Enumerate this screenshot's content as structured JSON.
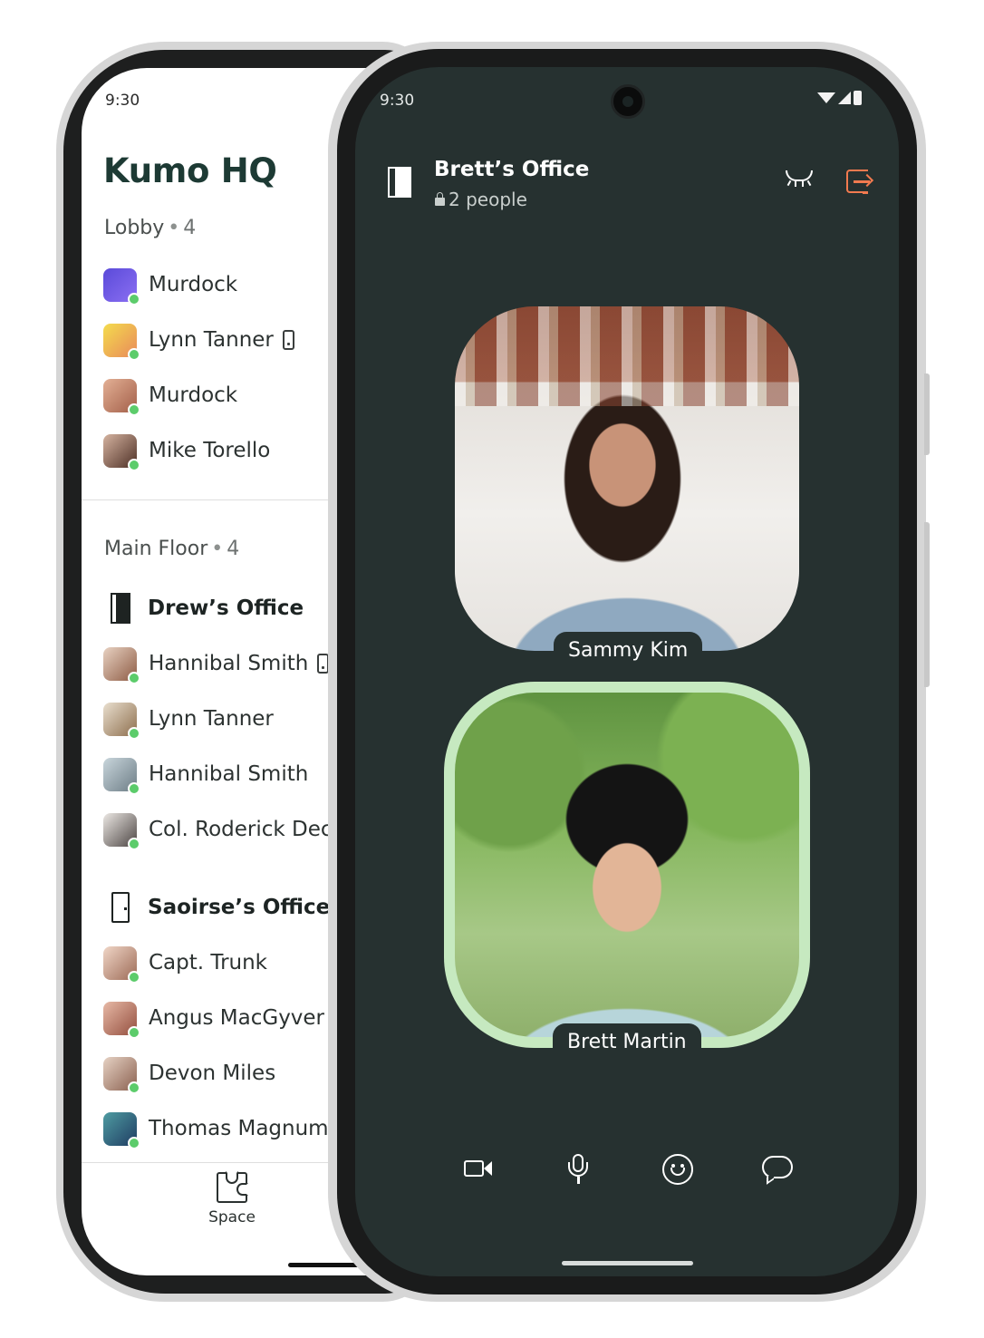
{
  "back_phone": {
    "status_time": "9:30",
    "app_title": "Kumo HQ",
    "lobby": {
      "title": "Lobby",
      "count": "4",
      "members": [
        {
          "name": "Murdock",
          "avatar_color": "#6b57e6",
          "on_mobile": false
        },
        {
          "name": "Lynn Tanner",
          "avatar_color": "#f0d34a",
          "on_mobile": true
        },
        {
          "name": "Murdock",
          "avatar_color": "#d99a7d",
          "on_mobile": false
        },
        {
          "name": "Mike Torello",
          "avatar_color": "#6b4436",
          "on_mobile": false
        }
      ]
    },
    "main_floor": {
      "title": "Main Floor",
      "count": "4",
      "rooms": [
        {
          "name": "Drew’s Office",
          "door": "closed",
          "members": [
            {
              "name": "Hannibal Smith",
              "avatar_color": "#b58a70",
              "on_mobile": true
            },
            {
              "name": "Lynn Tanner",
              "avatar_color": "#c7a37a",
              "on_mobile": false
            },
            {
              "name": "Hannibal Smith",
              "avatar_color": "#8a9aa3",
              "on_mobile": false
            },
            {
              "name": "Col. Roderick Dec",
              "avatar_color": "#6a6462",
              "on_mobile": false
            }
          ]
        },
        {
          "name": "Saoirse’s Office",
          "door": "open",
          "members": [
            {
              "name": "Capt. Trunk",
              "avatar_color": "#c99b86",
              "on_mobile": false
            },
            {
              "name": "Angus MacGyver",
              "avatar_color": "#b87565",
              "on_mobile": false
            },
            {
              "name": "Devon Miles",
              "avatar_color": "#a68270",
              "on_mobile": false
            },
            {
              "name": "Thomas Magnum",
              "avatar_color": "#2f6f6a",
              "on_mobile": false
            }
          ]
        }
      ]
    },
    "nav": {
      "space_label": "Space"
    }
  },
  "front_phone": {
    "status_time": "9:30",
    "room": {
      "name": "Brett’s Office",
      "occupancy": "2 people"
    },
    "participants": [
      {
        "name": "Sammy Kim",
        "speaking": false
      },
      {
        "name": "Brett Martin",
        "speaking": true
      }
    ],
    "colors": {
      "accent_leave": "#f27a4f",
      "speaking_ring": "#c6e9c0",
      "screen_bg": "#263130",
      "presence": "#5ccc6b"
    }
  }
}
